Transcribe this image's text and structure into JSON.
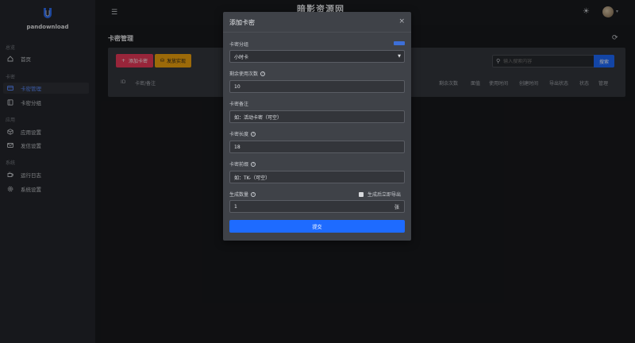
{
  "app": {
    "logo_name": "pandownload",
    "site_title": "暗影资源网"
  },
  "sidebar": {
    "sections": [
      {
        "title": "总览",
        "items": [
          {
            "label": "首页",
            "icon": "home-icon"
          }
        ]
      },
      {
        "title": "卡密",
        "items": [
          {
            "label": "卡密管理",
            "icon": "card-icon",
            "active": true
          },
          {
            "label": "卡密分组",
            "icon": "group-icon"
          }
        ]
      },
      {
        "title": "应用",
        "items": [
          {
            "label": "应用设置",
            "icon": "cube-icon"
          },
          {
            "label": "发信设置",
            "icon": "mail-icon"
          }
        ]
      },
      {
        "title": "系统",
        "items": [
          {
            "label": "运行日志",
            "icon": "log-icon"
          },
          {
            "label": "系统设置",
            "icon": "gear-icon"
          }
        ]
      }
    ]
  },
  "page": {
    "title": "卡密管理"
  },
  "toolbar": {
    "add_label": "添加卡密",
    "export_label": "发放实现",
    "search_placeholder": "输入搜索内容",
    "search_label": "搜索"
  },
  "table": {
    "headers": [
      "ID",
      "卡密/备注",
      "剩余次数",
      "面值",
      "使用时间",
      "创建时间",
      "导出状态",
      "状态",
      "管理"
    ]
  },
  "modal": {
    "title": "添加卡密",
    "close": "×",
    "group_label": "卡密分组",
    "group_value": "小时卡",
    "uses_label": "剩余使用次数",
    "uses_value": "10",
    "note_label": "卡密备注",
    "note_placeholder": "如：活动卡密（可空）",
    "length_label": "卡密长度",
    "length_value": "18",
    "prefix_label": "卡密前缀",
    "prefix_placeholder": "如：TK-（可空）",
    "count_label": "生成数量",
    "export_check_label": "生成后立即导出",
    "count_value": "1",
    "count_unit": "张",
    "submit_label": "提交"
  },
  "colors": {
    "primary": "#1e6bff",
    "danger": "#ea3a5a",
    "warning": "#f0a30f",
    "active_nav": "#5b8cff"
  }
}
